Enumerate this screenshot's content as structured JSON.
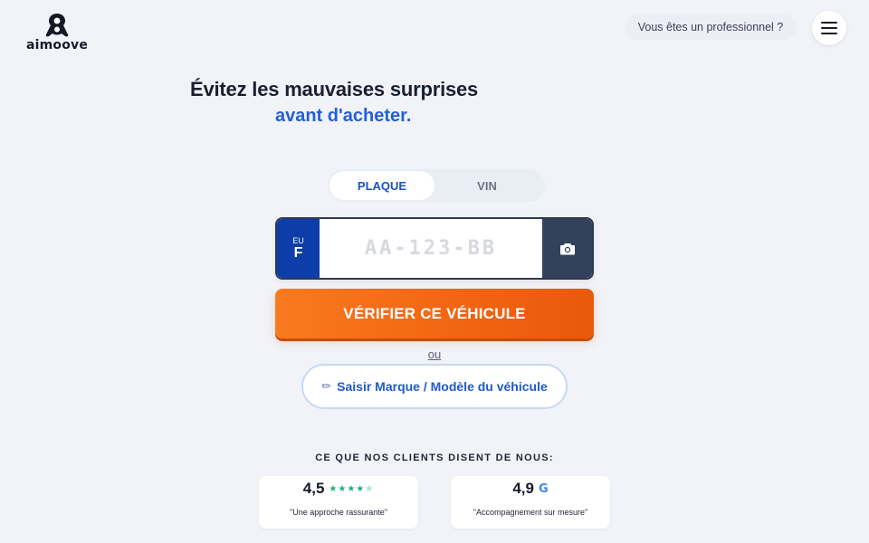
{
  "header": {
    "logo_text": "aimoove",
    "pro_link": "Vous êtes un professionnel ?",
    "menu_icon": "hamburger-icon"
  },
  "hero": {
    "title": "Évitez les mauvaises surprises",
    "subtitle": "avant d'acheter."
  },
  "search": {
    "tabs": [
      {
        "label": "PLAQUE",
        "active": true
      },
      {
        "label": "VIN",
        "active": false
      }
    ],
    "plate": {
      "eu_label": "EU",
      "country": "F",
      "placeholder": "AA-123-BB",
      "value": "",
      "camera_icon": "camera-icon"
    },
    "verify_label": "VÉRIFIER CE VÉHICULE",
    "or_label": "ou",
    "brand_model_label": "Saisir Marque / Modèle du véhicule",
    "brand_model_icon": "✏"
  },
  "reviews": {
    "title": "CE QUE NOS CLIENTS DISENT DE NOUS:",
    "items": [
      {
        "score": "4,5",
        "source_icon": "trustpilot-stars-icon",
        "stars": 4.5,
        "quote": "\"Une approche rassurante\""
      },
      {
        "score": "4,9",
        "source_icon": "google-icon",
        "quote": "\"Accompagnement sur mesure\""
      }
    ]
  },
  "colors": {
    "accent_blue": "#2360d8",
    "cta_orange": "#f26411",
    "plate_blue": "#0d3ea8",
    "background": "#f1f3f8"
  }
}
